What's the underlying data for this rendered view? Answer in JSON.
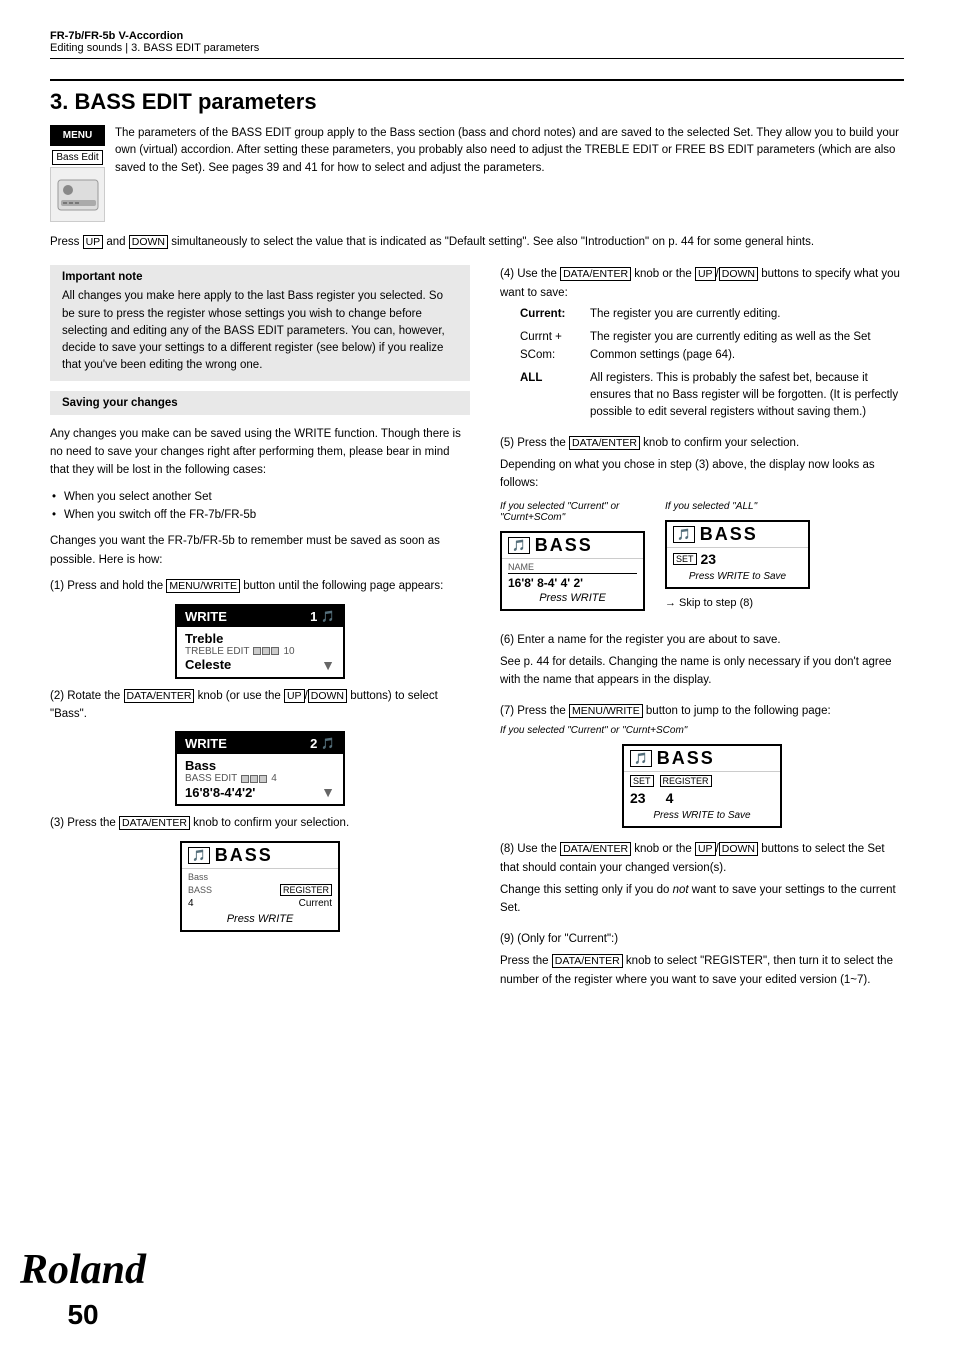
{
  "header": {
    "title": "FR-7b/FR-5b V-Accordion",
    "subtitle": "Editing sounds | 3. BASS EDIT parameters"
  },
  "section": {
    "number": "3.",
    "title": "BASS EDIT parameters"
  },
  "menu_label": "MENU",
  "bass_edit_label": "Bass Edit",
  "intro_text": "The parameters of the BASS EDIT group apply to the Bass section (bass and chord notes) and are saved to the selected Set. They allow you to build your own (virtual) accordion. After setting these parameters, you probably also need to adjust the TREBLE EDIT or FREE BS EDIT parameters (which are also saved to the Set). See pages 39 and 41 for how to select and adjust the parameters.",
  "press_line": "Press UP and DOWN simultaneously to select the value that is indicated as \"Default setting\". See also \"Introduction\" on p. 44 for some general hints.",
  "important_note": {
    "title": "Important note",
    "text": "All changes you make here apply to the last Bass register you selected. So be sure to press the register whose settings you wish to change before selecting and editing any of the BASS EDIT parameters. You can, however, decide to save your settings to a different register (see below) if you realize that you've been editing the wrong one."
  },
  "saving_changes": {
    "title": "Saving your changes",
    "text": "Any changes you make can be saved using the WRITE function. Though there is no need to save your changes right after performing them, please bear in mind that they will be lost in the following cases:",
    "bullets": [
      "When you select another Set",
      "When you switch off the FR-7b/FR-5b"
    ],
    "after_bullets": "Changes you want the FR-7b/FR-5b to remember must be saved as soon as possible. Here is how:"
  },
  "steps_left": [
    {
      "num": "(1)",
      "text": "Press and hold the MENU/WRITE button until the following page appears:"
    },
    {
      "num": "(2)",
      "text": "Rotate the DATA/ENTER knob (or use the UP/DOWN buttons) to select \"Bass\"."
    },
    {
      "num": "(3)",
      "text": "Press the DATA/ENTER knob to confirm your selection."
    }
  ],
  "steps_right": [
    {
      "num": "(4)",
      "text": "Use the DATA/ENTER knob or the UP/DOWN buttons to specify what you want to save:",
      "indent_items": [
        {
          "key": "Current:",
          "value": "The register you are currently editing."
        },
        {
          "key": "Currnt + SCom:",
          "value": "The register you are currently editing as well as the Set Common settings (page 64)."
        },
        {
          "key": "ALL",
          "value": "All registers. This is probably the safest bet, because it ensures that no Bass register will be forgotten. (It is perfectly possible to edit several registers without saving them.)"
        }
      ]
    },
    {
      "num": "(5)",
      "text": "Press the DATA/ENTER knob to confirm your selection.",
      "extra": "Depending on what you chose in step (3) above, the display now looks as follows:"
    },
    {
      "num": "(6)",
      "text": "Enter a name for the register you are about to save.",
      "extra": "See p. 44 for details. Changing the name is only necessary if you don't agree with the name that appears in the display."
    },
    {
      "num": "(7)",
      "text": "Press the MENU/WRITE button to jump to the following page:",
      "sub_caption": "If you selected \"Current\" or \"Curnt+SCom\""
    },
    {
      "num": "(8)",
      "text": "Use the DATA/ENTER knob or the UP/DOWN buttons to select the Set that should contain your changed version(s).",
      "extra": "Change this setting only if you do not want to save your settings to the current Set."
    },
    {
      "num": "(9)",
      "text": "(Only for \"Current\":)",
      "extra": "Press the DATA/ENTER knob to select \"REGISTER\", then turn it to select the number of the register where you want to save your edited version (1~7)."
    }
  ],
  "display_write1": {
    "header": "WRITE",
    "num": "1",
    "items": [
      "Treble",
      "TREBLE EDIT",
      "10",
      "Celeste"
    ],
    "scroll": "▼"
  },
  "display_write2": {
    "header": "WRITE",
    "num": "2",
    "items": [
      "Bass",
      "BASS EDIT",
      "4",
      "16'8'8-4'4'2'"
    ],
    "scroll": "▼"
  },
  "display_bass_step3": {
    "title": "BASS",
    "row1_label": "Bass",
    "row2_label": "BASS",
    "register_label": "REGISTER",
    "register_value": "Current",
    "press_write": "Press WRITE"
  },
  "display_bass_current": {
    "title": "BASS",
    "name_label": "NAME",
    "value": "16'8'8-4'4'2'",
    "press_write": "Press WRITE"
  },
  "display_bass_all": {
    "title": "BASS",
    "set_label": "SET",
    "set_value": "23",
    "press_write_save": "Press WRITE to Save",
    "caption_label": "If you selected \"ALL\""
  },
  "display_bass_step7": {
    "title": "BASS",
    "set_label": "SET",
    "set_value": "23",
    "register_label": "REGISTER",
    "register_value": "4",
    "press_write_save": "Press WRITE to Save",
    "caption": "If you selected \"Current\" or \"Curnt+SCom\""
  },
  "caption_current_label": "If you selected \"Current\" or \"Curnt+SCom\"",
  "skip_to_step8": "→ Skip to step (8)",
  "roland_logo": "Roland",
  "page_number": "50"
}
